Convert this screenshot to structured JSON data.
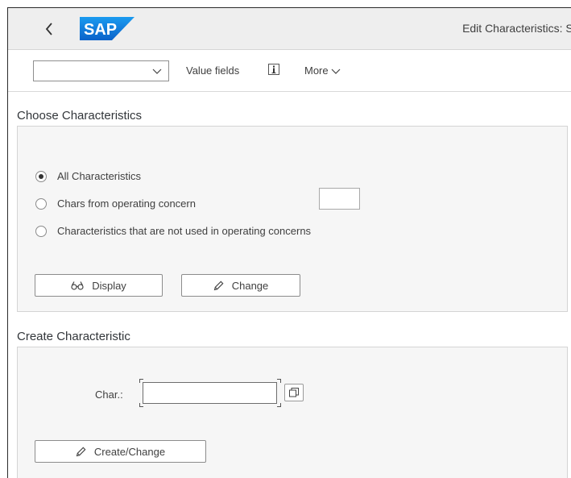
{
  "shell": {
    "logo_text": "SAP",
    "title": "Edit Characteristics: Start"
  },
  "toolbar": {
    "combo_value": "",
    "value_fields_label": "Value fields",
    "more_label": "More"
  },
  "choose": {
    "title": "Choose Characteristics",
    "options": [
      {
        "label": "All Characteristics",
        "selected": true
      },
      {
        "label": "Chars from operating concern",
        "selected": false
      },
      {
        "label": "Characteristics that are not used in operating concerns",
        "selected": false
      }
    ],
    "operating_concern_value": "",
    "display_label": "Display",
    "change_label": "Change"
  },
  "create": {
    "title": "Create Characteristic",
    "char_label": "Char.:",
    "char_value": "",
    "create_change_label": "Create/Change"
  },
  "colors": {
    "logo_blue": "#0a6ed1",
    "shell_bg": "#eeeeee",
    "group_bg": "#f6f6f6"
  },
  "icons": [
    "back-chevron-icon",
    "dropdown-chevron-icon",
    "info-icon",
    "glasses-icon",
    "pencil-icon",
    "value-help-icon"
  ]
}
